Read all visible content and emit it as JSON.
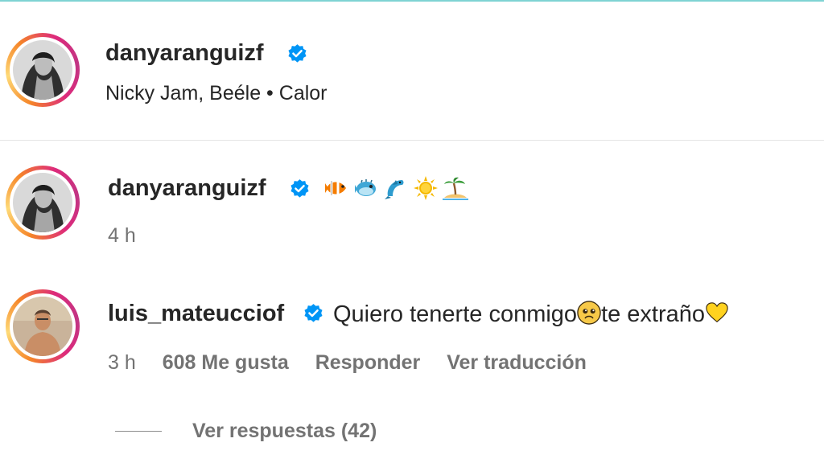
{
  "post": {
    "username": "danyaranguizf",
    "music": "Nicky Jam, Beéle • Calor"
  },
  "comments": [
    {
      "username": "danyaranguizf",
      "emojis": [
        "tropical-fish",
        "blowfish",
        "dolphin",
        "sun",
        "desert-island"
      ],
      "time": "4 h"
    },
    {
      "username": "luis_mateucciof",
      "text_part1": "Quiero tenerte conmigo",
      "text_part2": "te extraño",
      "time": "3 h",
      "likes": "608 Me gusta",
      "reply": "Responder",
      "translate": "Ver traducción"
    }
  ],
  "replies": {
    "label": "Ver respuestas (42)"
  },
  "colors": {
    "verified": "#0095f6",
    "muted": "#737373",
    "text": "#262626",
    "top_line": "#7fd3d3"
  }
}
